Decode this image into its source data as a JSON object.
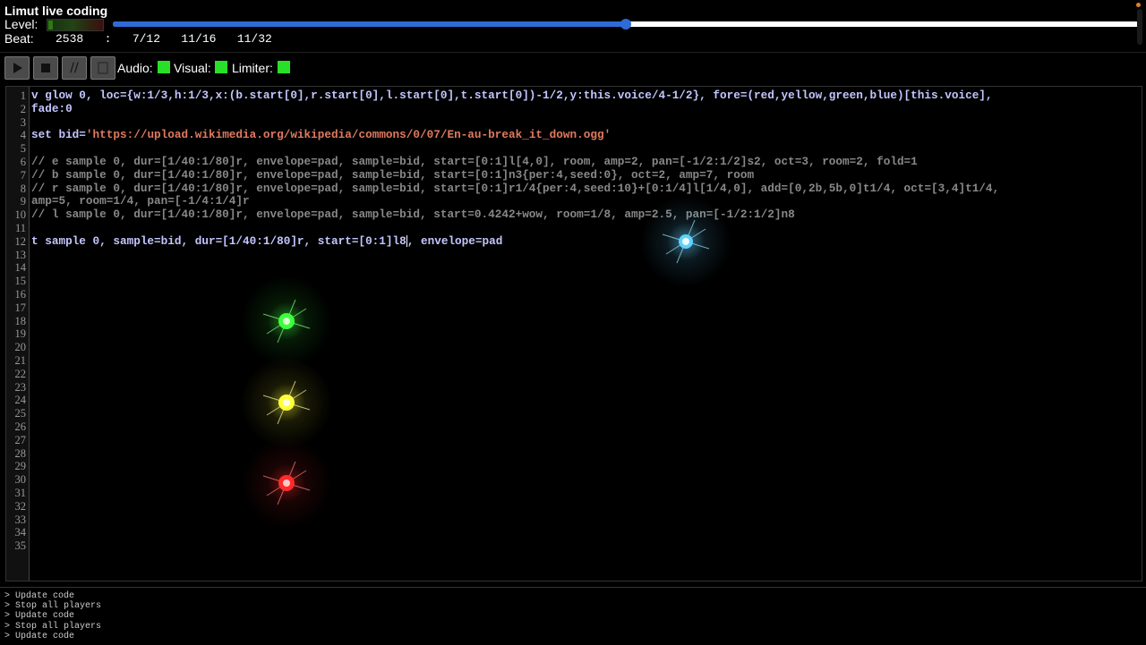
{
  "app": {
    "title": "Limut live coding",
    "level_label": "Level:",
    "level_value": 0.08,
    "beat_label": "Beat:",
    "beat_values": "2538   :   7/12   11/16   11/32",
    "progress_value": 0.5
  },
  "toolbar": {
    "play_icon": "play-icon",
    "stop_icon": "stop-icon",
    "comment_label": "//",
    "audio_label": "Audio:",
    "visual_label": "Visual:",
    "limiter_label": "Limiter:",
    "status_color": "#29e029"
  },
  "editor": {
    "line_numbers": [
      "1",
      "2",
      "3",
      "4",
      "5",
      "6",
      "7",
      "8",
      "9",
      "10",
      "11",
      "12",
      "13",
      "14",
      "15",
      "16",
      "17",
      "18",
      "19",
      "20",
      "21",
      "22",
      "23",
      "24",
      "25",
      "26",
      "27",
      "28",
      "29",
      "30",
      "31",
      "32",
      "33",
      "34",
      "35"
    ],
    "lines": {
      "l1a": "v glow 0, loc={w:1/3,h:1/3,x:(b.start[0],r.start[0],l.start[0],t.start[0])-1/2,y:this.voice/4-1/2}, fore=(red,yellow,green,blue)[this.voice],",
      "l1b": "fade:0",
      "l3_kw": "set bid=",
      "l3_str": "'https://upload.wikimedia.org/wikipedia/commons/0/07/En-au-break_it_down.ogg'",
      "l5": "// e sample 0, dur=[1/40:1/80]r, envelope=pad, sample=bid, start=[0:1]l[4,0], room, amp=2, pan=[-1/2:1/2]s2, oct=3, room=2, fold=1",
      "l6": "// b sample 0, dur=[1/40:1/80]r, envelope=pad, sample=bid, start=[0:1]n3{per:4,seed:0}, oct=2, amp=7, room",
      "l7a": "// r sample 0, dur=[1/40:1/80]r, envelope=pad, sample=bid, start=[0:1]r1/4{per:4,seed:10}+[0:1/4]l[1/4,0], add=[0,2b,5b,0]t1/4, oct=[3,4]t1/4,",
      "l7b": "amp=5, room=1/4, pan=[-1/4:1/4]r",
      "l8": "// l sample 0, dur=[1/40:1/80]r, envelope=pad, sample=bid, start=0.4242+wow, room=1/8, amp=2.5, pan=[-1/2:1/2]n8",
      "l10a": "t sample 0, sample=bid, dur=[1/40:1/80]r, start=[0:1]l8",
      "l10b": ", envelope=pad"
    },
    "glow_colors": {
      "blue": "#5fd0ff",
      "green": "#3cff3c",
      "yellow": "#ffff3a",
      "red": "#ff2a2a"
    }
  },
  "console": {
    "lines": [
      "> Update code",
      "> Stop all players",
      "> Update code",
      "> Stop all players",
      "> Update code"
    ]
  }
}
